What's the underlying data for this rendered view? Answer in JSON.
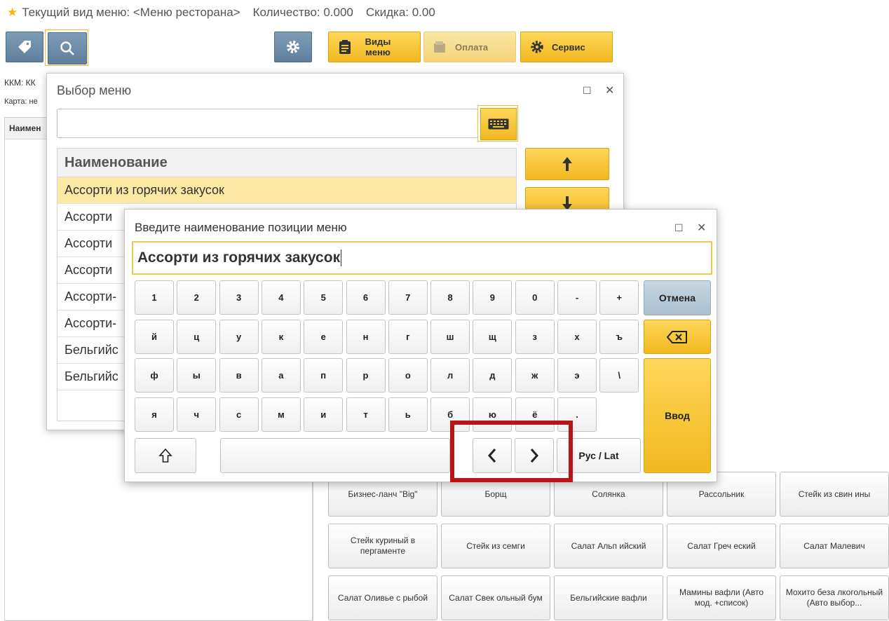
{
  "header": {
    "view_label": "Текущий вид меню: <Меню ресторана>",
    "qty_label": "Количество: 0.000",
    "discount_label": "Скидка: 0.00"
  },
  "toolbar": {
    "menu_types": "Виды меню",
    "payment": "Оплата",
    "service": "Сервис"
  },
  "background": {
    "kkm_label": "ККМ: КК",
    "card_label": "Карта: не",
    "table_header": "Наимен"
  },
  "grid": [
    [
      "Бизнес-ланч \"Big\"",
      "Борщ",
      "Солянка",
      "Рассольник",
      "Стейк из свин ины"
    ],
    [
      "Стейк куриный в пергаменте",
      "Стейк из семги",
      "Салат Альп ийский",
      "Салат Греч еский",
      "Салат Малевич"
    ],
    [
      "Салат Оливье с рыбой",
      "Салат Свек ольный бум",
      "Бельгийские вафли",
      "Мамины вафли (Авто мод. +список)",
      "Мохито беза лкогольный (Авто выбор..."
    ]
  ],
  "menu_dialog": {
    "title": "Выбор меню",
    "search_value": "",
    "column_header": "Наименование",
    "items": [
      "Ассорти из горячих закусок",
      "Ассорти",
      "Ассорти",
      "Ассорти",
      "Ассорти-",
      "Ассорти-",
      "Бельгийс",
      "Бельгийс"
    ]
  },
  "keyboard_dialog": {
    "title": "Введите наименование позиции меню",
    "input_value": "Ассорти из горячих закусок",
    "rows": [
      [
        "1",
        "2",
        "3",
        "4",
        "5",
        "6",
        "7",
        "8",
        "9",
        "0",
        "-",
        "+"
      ],
      [
        "й",
        "ц",
        "у",
        "к",
        "е",
        "н",
        "г",
        "ш",
        "щ",
        "з",
        "х",
        "ъ"
      ],
      [
        "ф",
        "ы",
        "в",
        "а",
        "п",
        "р",
        "о",
        "л",
        "д",
        "ж",
        "э",
        "\\"
      ],
      [
        "я",
        "ч",
        "с",
        "м",
        "и",
        "т",
        "ь",
        "б",
        "ю",
        "ё",
        "."
      ]
    ],
    "cancel": "Отмена",
    "enter": "Ввод",
    "lang": "Рус / Lat"
  }
}
